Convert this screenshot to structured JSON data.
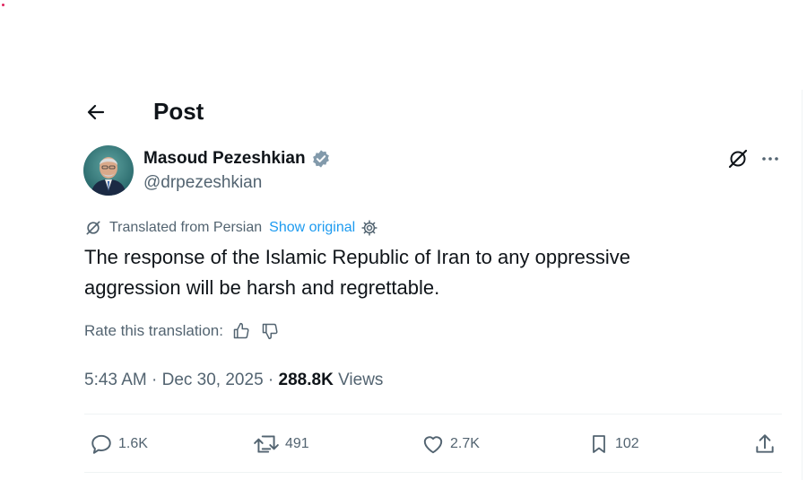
{
  "header": {
    "title": "Post"
  },
  "author": {
    "display_name": "Masoud Pezeshkian",
    "handle": "@drpezeshkian",
    "verified": true
  },
  "translation": {
    "label": "Translated from Persian",
    "show_original": "Show original",
    "rate_label": "Rate this translation:"
  },
  "post": {
    "text": "The response of the Islamic Republic of Iran to any oppressive aggression will be harsh and regrettable.",
    "time": "5:43 AM",
    "date": "Dec 30, 2025",
    "views_count": "288.8K",
    "views_label": "Views",
    "separator": "·"
  },
  "actions": {
    "replies": "1.6K",
    "reposts": "491",
    "likes": "2.7K",
    "bookmarks": "102"
  },
  "colors": {
    "accent": "#1d9bf0",
    "text_primary": "#0f1419",
    "text_secondary": "#536471",
    "divider": "#eff3f4"
  },
  "icons": [
    "back-arrow-icon",
    "verified-badge-icon",
    "grok-icon",
    "more-icon",
    "translate-icon",
    "gear-icon",
    "thumbs-up-icon",
    "thumbs-down-icon",
    "reply-icon",
    "repost-icon",
    "like-icon",
    "bookmark-icon",
    "share-icon"
  ]
}
